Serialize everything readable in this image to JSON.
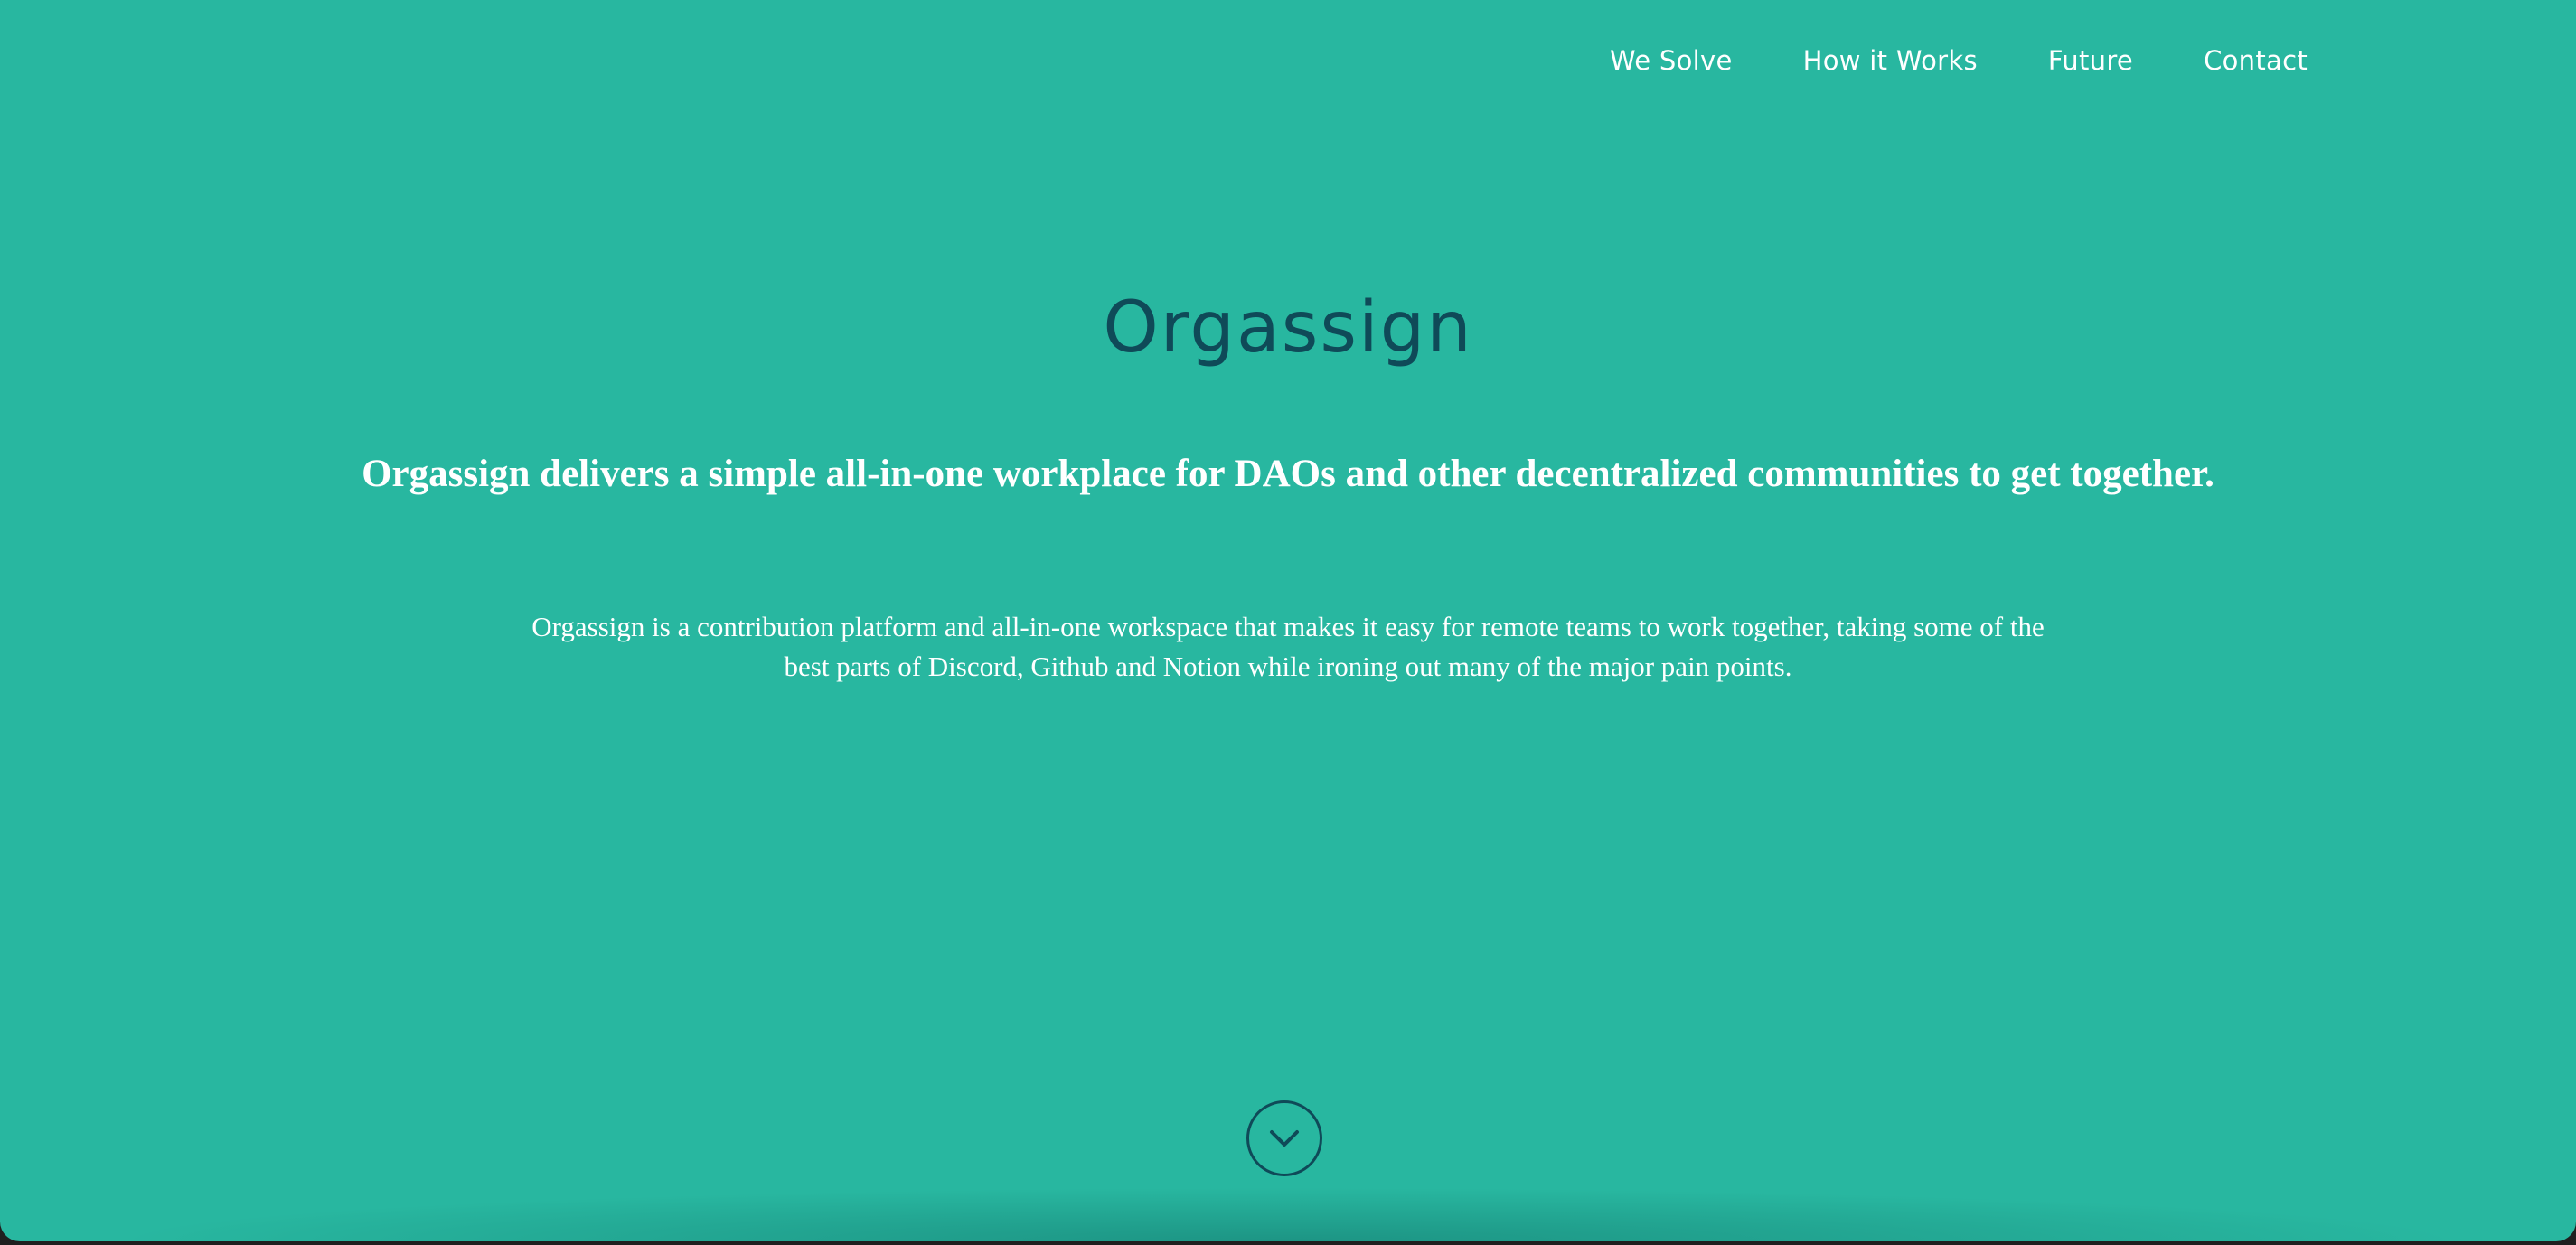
{
  "nav": {
    "items": [
      {
        "label": "We Solve"
      },
      {
        "label": "How it Works"
      },
      {
        "label": "Future"
      },
      {
        "label": "Contact"
      }
    ]
  },
  "hero": {
    "title": "Orgassign",
    "subtitle": "Orgassign delivers a simple all-in-one workplace for DAOs and other decentralized communities to get together.",
    "body_line_1": "Orgassign is a contribution platform and all-in-one workspace that makes it easy for remote teams to work together, taking some of the",
    "body_line_2": "best parts of Discord, Github and Notion while ironing out many of the major pain points."
  },
  "scroll": {
    "icon": "chevron-down-circle-icon"
  },
  "colors": {
    "background": "#28b7a0",
    "accent_dark": "#0f4a58",
    "text_light": "#ffffff"
  }
}
